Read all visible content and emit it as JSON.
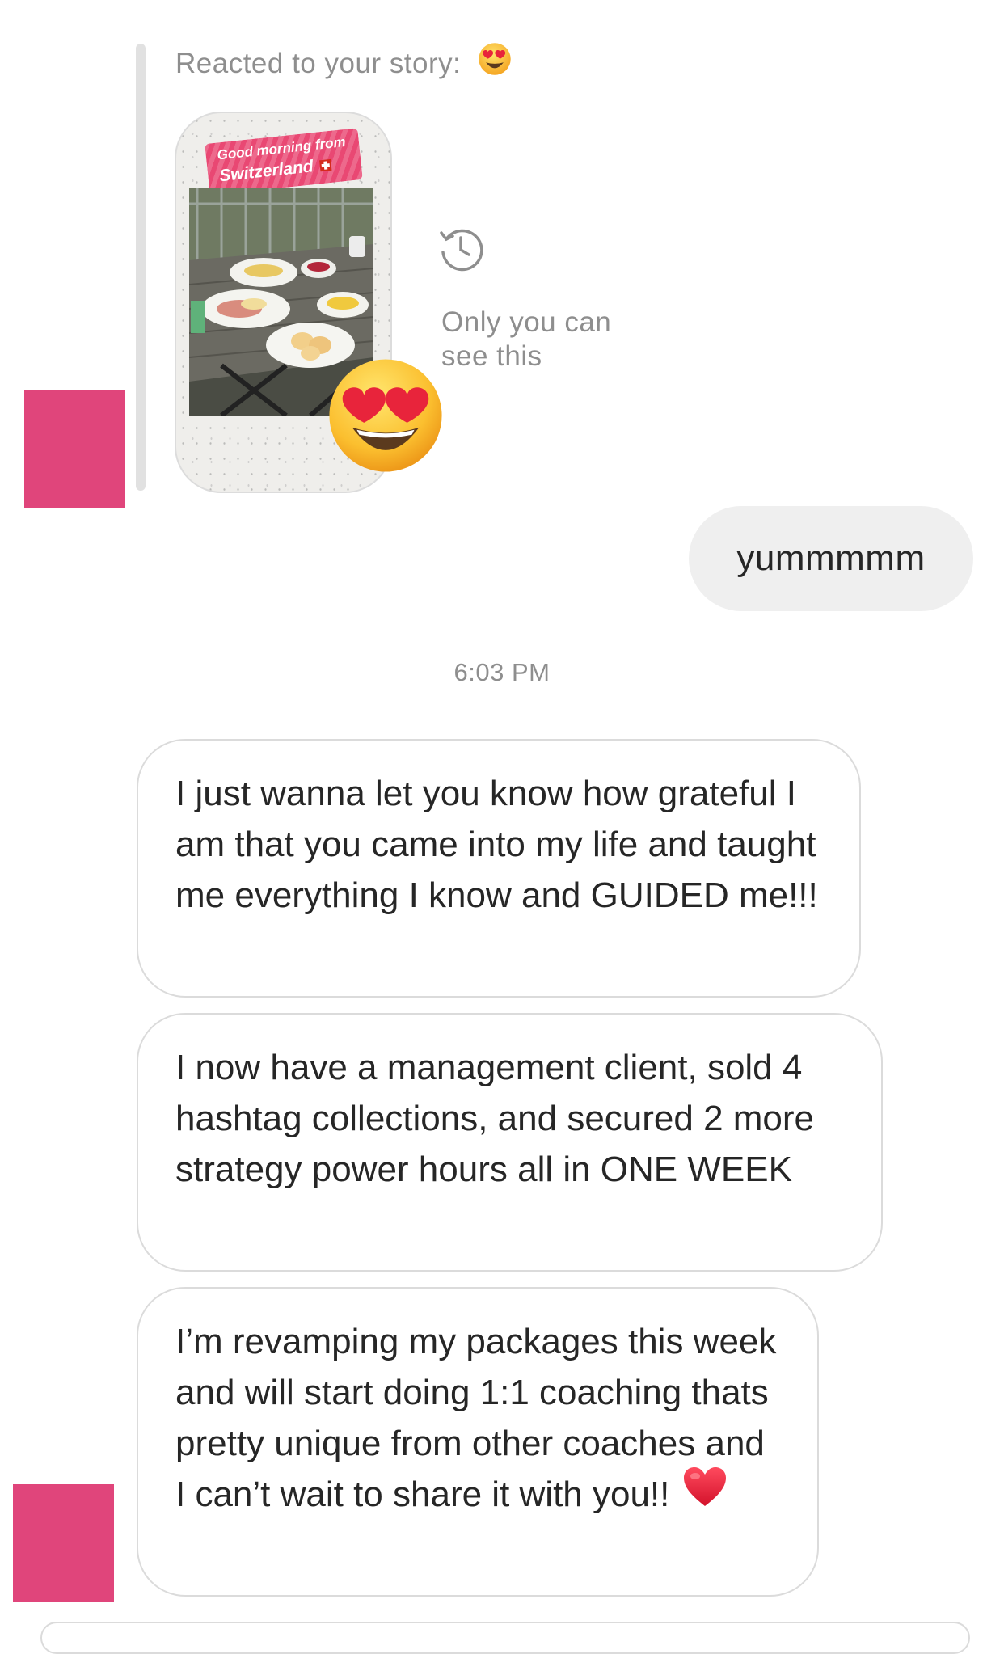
{
  "story_reply": {
    "reacted_label": "Reacted to your story:",
    "reaction": "heart-eyes-emoji",
    "story_banner": {
      "line1": "Good morning from",
      "line2": "Switzerland"
    },
    "visibility_note": "Only you can see this"
  },
  "sent_message": "yummmmm",
  "timestamp": "6:03 PM",
  "received_messages": [
    "I just wanna let you know how grateful I am that you came into my life and taught me everything I know and GUIDED me!!!",
    "I now have a management client, sold 4 hashtag collections, and secured 2 more strategy power hours all in ONE WEEK",
    "I’m revamping my packages this week and will start doing 1:1 coaching thats pretty unique from other coaches and I can’t wait to share it with you!!"
  ],
  "icons": [
    "heart-eyes-emoji",
    "clock-history-icon",
    "red-heart-emoji",
    "swiss-flag-icon"
  ],
  "colors": {
    "avatar": "#e0457b",
    "banner": "#e94873",
    "sent_bubble": "#efefef",
    "muted_text": "#8e8e8e",
    "bubble_border": "#dbdbdb"
  }
}
